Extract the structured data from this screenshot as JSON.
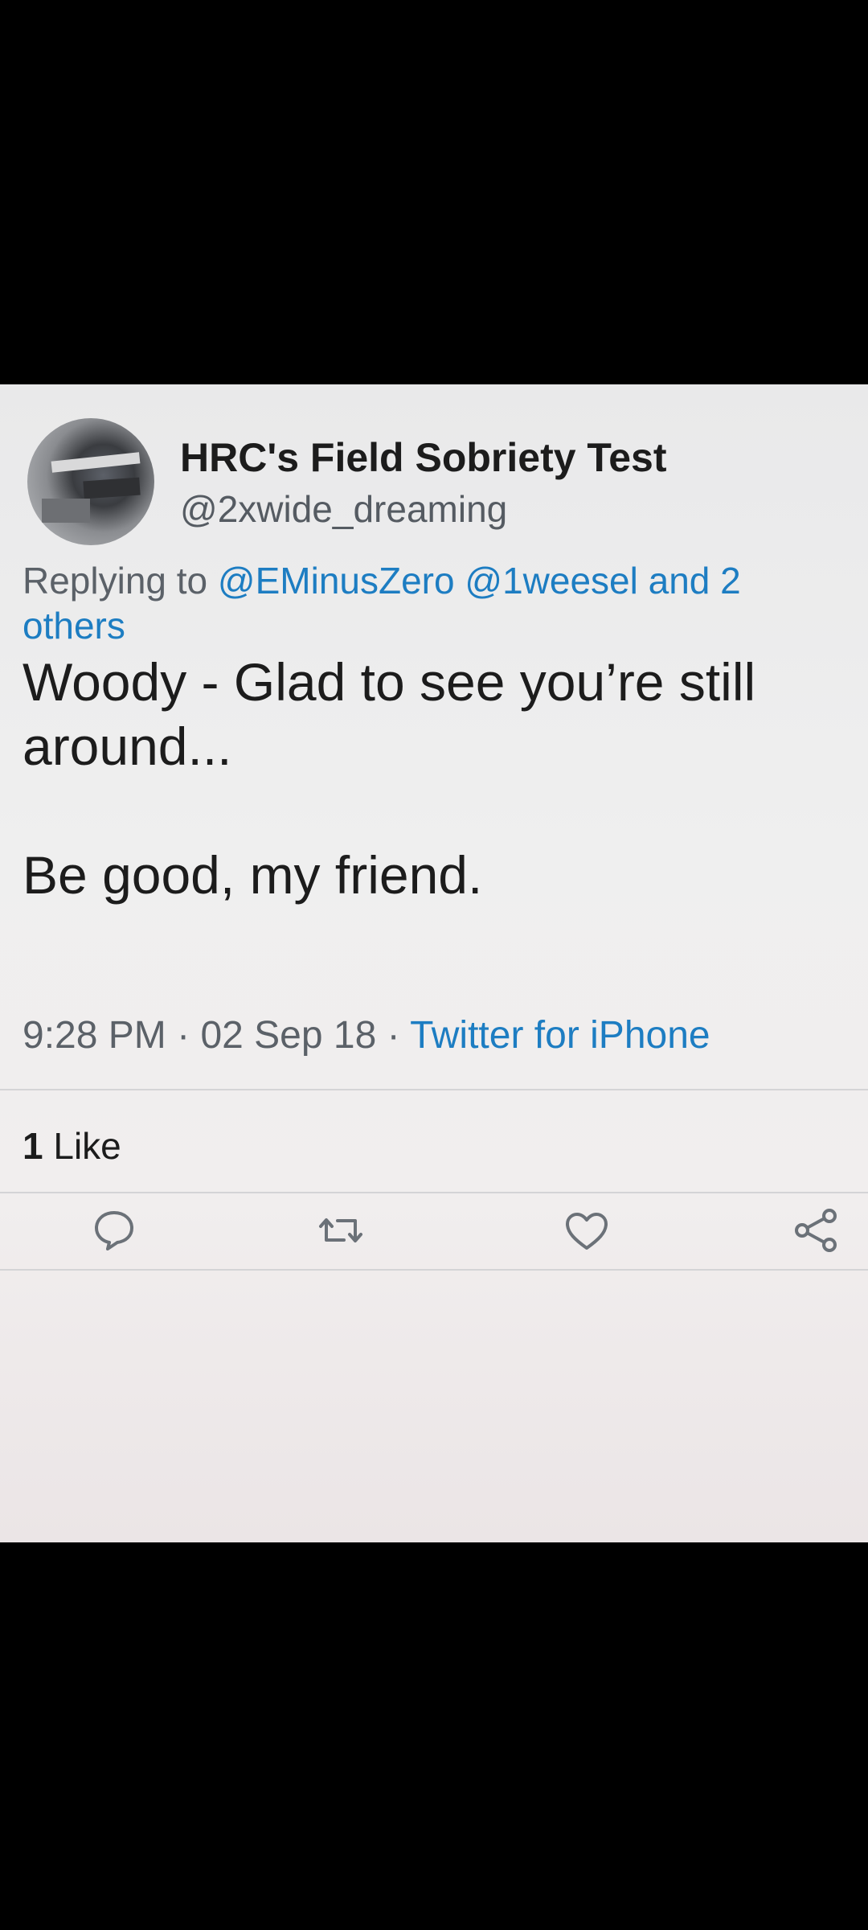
{
  "tweet": {
    "display_name": "HRC's Field Sobriety Test",
    "handle": "@2xwide_dreaming",
    "replying_prefix": "Replying to",
    "replying_mentions": "@EMinusZero @1weesel",
    "replying_suffix": "and 2 others",
    "text_line1": "Woody - Glad to see you’re still around...",
    "text_line2": "Be good, my friend.",
    "time": "9:28 PM",
    "date": "02 Sep 18",
    "separator": "·",
    "source": "Twitter for iPhone",
    "likes_count": "1",
    "likes_label": "Like"
  },
  "actions": {
    "reply_icon": "reply-icon",
    "retweet_icon": "retweet-icon",
    "like_icon": "heart-icon",
    "share_icon": "share-icon"
  },
  "colors": {
    "link": "#1d7dc2",
    "secondary_text": "#5b6168",
    "primary_text": "#1c1c1c"
  }
}
